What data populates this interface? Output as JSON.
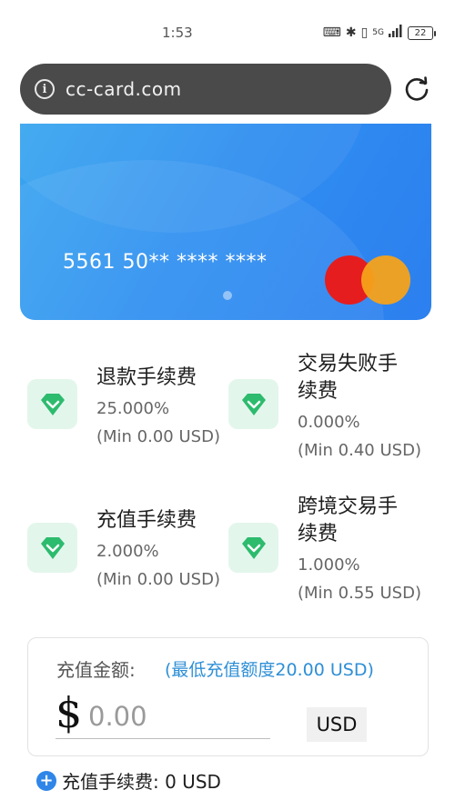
{
  "status_bar": {
    "time": "1:53",
    "signal": "5G",
    "battery": "22"
  },
  "browser": {
    "url": "cc-card.com"
  },
  "card": {
    "number": "5561 50** **** ****"
  },
  "fees": [
    {
      "title": "退款手续费",
      "rate": "25.000%",
      "min": "(Min 0.00 USD)"
    },
    {
      "title_line1": "交易失败手",
      "title_line2": "续费",
      "rate": "0.000%",
      "min": "(Min 0.40 USD)"
    },
    {
      "title": "充值手续费",
      "rate": "2.000%",
      "min": "(Min 0.00 USD)"
    },
    {
      "title_line1": "跨境交易手",
      "title_line2": "续费",
      "rate": "1.000%",
      "min": "(Min 0.55 USD)"
    }
  ],
  "recharge": {
    "label": "充值金额:",
    "hint": "(最低充值额度20.00 USD)",
    "currency_symbol": "$",
    "amount_placeholder": "0.00",
    "currency": "USD",
    "fee_text": "充值手续费:  0 USD"
  },
  "colors": {
    "card_blue": "#2f8ff0",
    "accent_green": "#2dbb6e",
    "hint_blue": "#2e8fd6"
  }
}
